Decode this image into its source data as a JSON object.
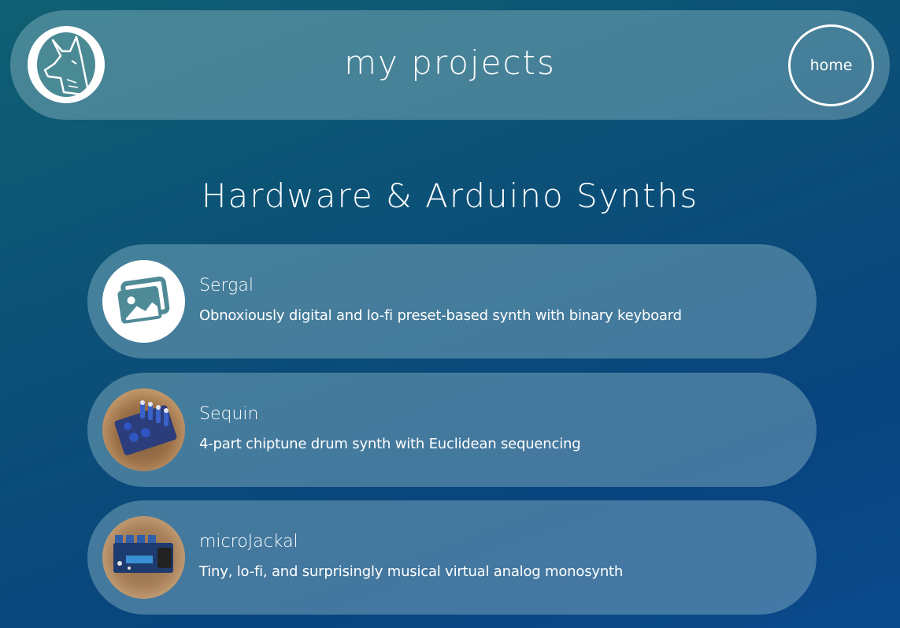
{
  "header": {
    "title": "my projects",
    "home_label": "home",
    "logo_icon": "wolf-head-logo-icon"
  },
  "section": {
    "title": "Hardware & Arduino Synths"
  },
  "projects": [
    {
      "name": "Sergal",
      "description": "Obnoxiously digital and lo-fi preset-based synth with binary keyboard",
      "thumbnail": "image-placeholder-icon"
    },
    {
      "name": "Sequin",
      "description": "4-part chiptune drum synth with Euclidean sequencing",
      "thumbnail": "sequin-photo"
    },
    {
      "name": "microJackal",
      "description": "Tiny, lo-fi, and surprisingly musical virtual analog monosynth",
      "thumbnail": "microjackal-photo"
    }
  ],
  "colors": {
    "background_start": "#0f5f72",
    "background_end": "#0a4a8c",
    "card_fill": "#8fbccb",
    "text": "#ffffff"
  }
}
